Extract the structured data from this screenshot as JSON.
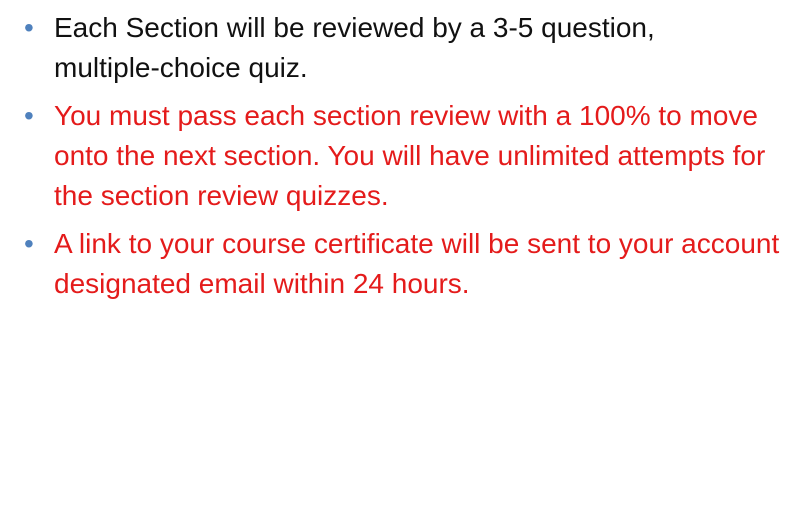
{
  "slide": {
    "bullets": [
      {
        "text": "Each Section will be reviewed by a 3-5 question, multiple-choice quiz.",
        "color": "#111111"
      },
      {
        "text": "You must pass each section review with a 100% to move onto the next section.  You will have unlimited attempts for the section review quizzes.",
        "color": "#e41b1b"
      },
      {
        "text": "A link to your course certificate will be sent to your account designated email within 24 hours.",
        "color": "#e41b1b"
      }
    ],
    "bullet_glyph": "•",
    "bullet_color": "#4f81bd"
  }
}
